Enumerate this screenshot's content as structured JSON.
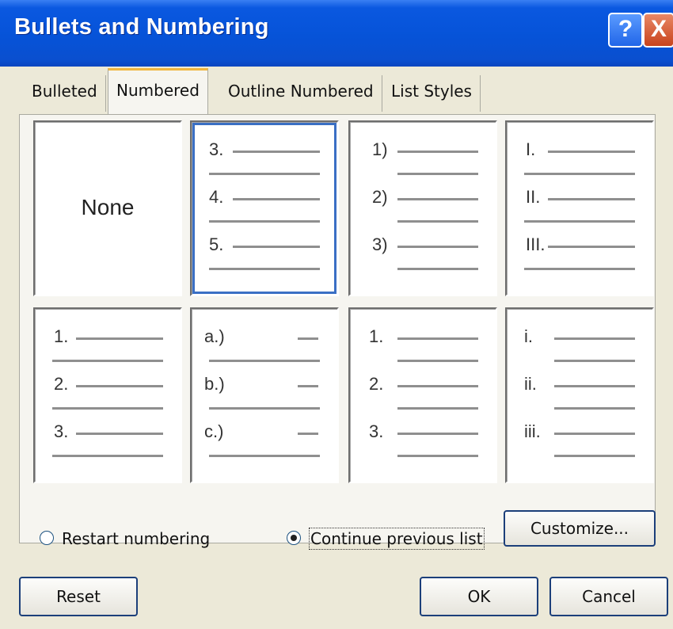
{
  "window": {
    "title": "Bullets and Numbering",
    "help_label": "?",
    "close_label": "X"
  },
  "tabs": [
    {
      "label": "Bulleted",
      "active": false
    },
    {
      "label": "Numbered",
      "active": true
    },
    {
      "label": "Outline Numbered",
      "active": false
    },
    {
      "label": "List Styles",
      "active": false
    }
  ],
  "gallery": {
    "none_label": "None",
    "styles": [
      {
        "markers": [
          "3.",
          "4.",
          "5."
        ],
        "selected": true
      },
      {
        "markers": [
          "1)",
          "2)",
          "3)"
        ]
      },
      {
        "markers": [
          "I.",
          "II.",
          "III."
        ]
      },
      {
        "markers": [
          "1.",
          "2.",
          "3."
        ]
      },
      {
        "markers": [
          "a.)",
          "b.)",
          "c.)"
        ]
      },
      {
        "markers": [
          "1.",
          "2.",
          "3."
        ]
      },
      {
        "markers": [
          "i.",
          "ii.",
          "iii."
        ]
      }
    ]
  },
  "options": {
    "restart_label": "Restart numbering",
    "continue_label": "Continue previous list",
    "selected": "continue",
    "customize_label": "Customize..."
  },
  "buttons": {
    "reset": "Reset",
    "ok": "OK",
    "cancel": "Cancel"
  }
}
